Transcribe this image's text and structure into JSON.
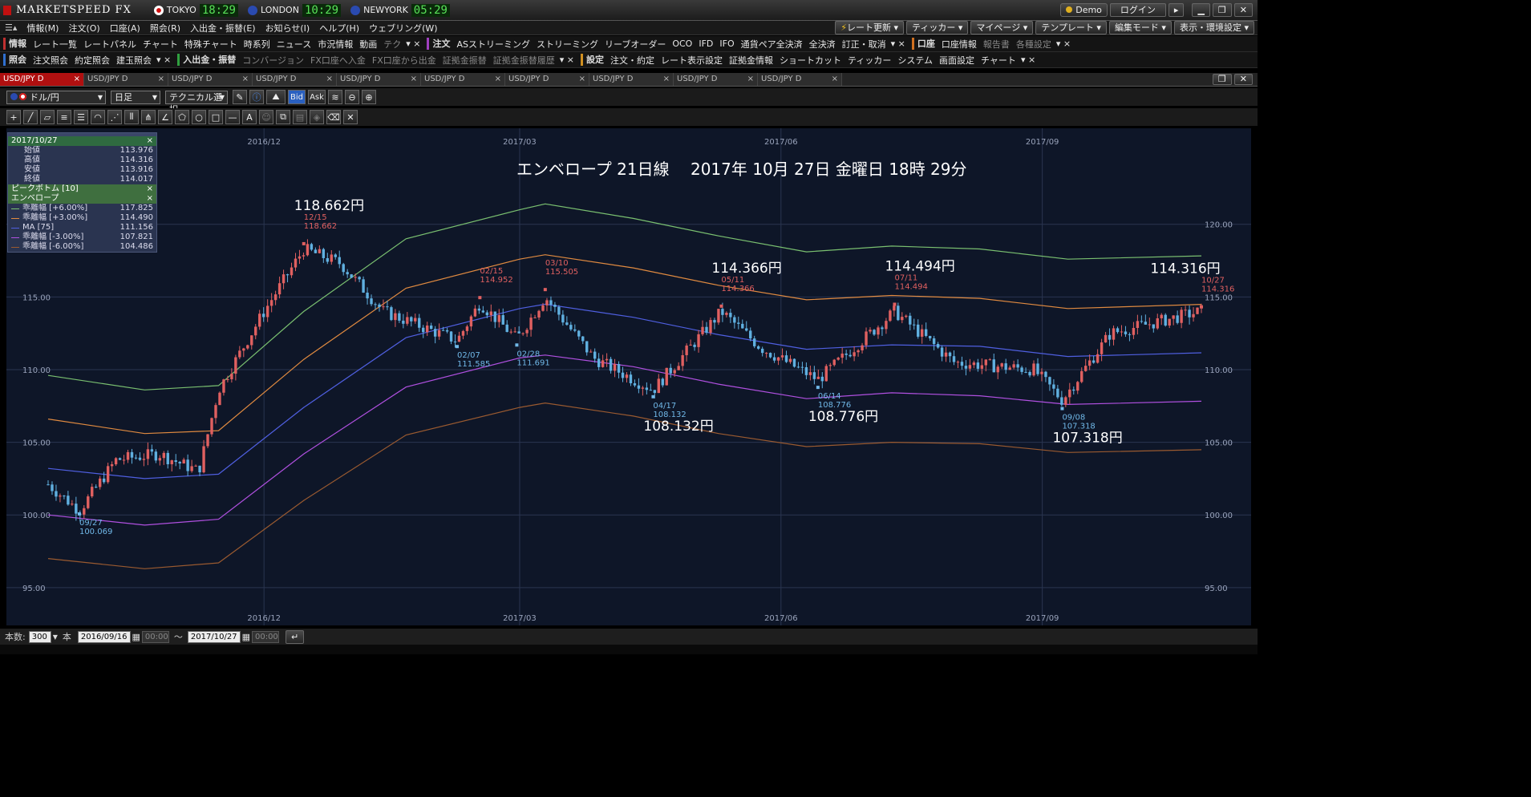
{
  "app": {
    "title": "MARKETSPEED FX"
  },
  "clocks": [
    {
      "city": "TOKYO",
      "time": "18:29",
      "flag_color": "#d01010"
    },
    {
      "city": "LONDON",
      "time": "10:29",
      "flag_color": "#2a4ab0"
    },
    {
      "city": "NEWYORK",
      "time": "05:29",
      "flag_color": "#2a4ab0"
    }
  ],
  "top_right": {
    "demo": "Demo",
    "login": "ログイン"
  },
  "menu": [
    "情報(M)",
    "注文(O)",
    "口座(A)",
    "照会(R)",
    "入出金・振替(E)",
    "お知らせ(I)",
    "ヘルプ(H)",
    "ウェブリング(W)"
  ],
  "menu_right": [
    "レート更新",
    "ティッカー",
    "マイページ",
    "テンプレート",
    "編集モード",
    "表示・環境設定"
  ],
  "toolbar1": {
    "groups": [
      {
        "label": "情報",
        "color": "#c03030",
        "items": [
          "レート一覧",
          "レートパネル",
          "チャート",
          "特殊チャート",
          "時系列",
          "ニュース",
          "市況情報",
          "動画",
          "テク"
        ]
      },
      {
        "label": "注文",
        "color": "#a040c0",
        "items": [
          "ASストリーミング",
          "ストリーミング",
          "リーブオーダー",
          "OCO",
          "IFD",
          "IFO",
          "通貨ペア全決済",
          "全決済",
          "訂正・取消"
        ]
      },
      {
        "label": "口座",
        "color": "#d07020",
        "items": [
          "口座情報",
          "報告書",
          "各種設定"
        ]
      }
    ]
  },
  "toolbar2": {
    "groups": [
      {
        "label": "照会",
        "color": "#3070d0",
        "items": [
          "注文照会",
          "約定照会",
          "建玉照会"
        ]
      },
      {
        "label": "入出金・振替",
        "color": "#30a040",
        "items": [
          "コンバージョン",
          "FX口座へ入金",
          "FX口座から出金",
          "証拠金振替",
          "証拠金振替履歴"
        ]
      },
      {
        "label": "設定",
        "color": "#d09020",
        "items": [
          "注文・約定",
          "レート表示設定",
          "証拠金情報",
          "ショートカット",
          "ティッカー",
          "システム",
          "画面設定",
          "チャート"
        ]
      }
    ]
  },
  "tabs": [
    "USD/JPY D",
    "USD/JPY D",
    "USD/JPY D",
    "USD/JPY D",
    "USD/JPY D",
    "USD/JPY D",
    "USD/JPY D",
    "USD/JPY D",
    "USD/JPY D",
    "USD/JPY D"
  ],
  "chart_controls": {
    "pair": "ドル/円",
    "period": "日足",
    "technical": "テクニカル選択",
    "bid": "Bid",
    "ask": "Ask"
  },
  "drawing_tools": [
    "crosshair",
    "trend-line",
    "ruler",
    "parallel-lines",
    "fib-lines",
    "fib-arc",
    "fib-fan",
    "vertical-lines",
    "pitchfork",
    "angle",
    "pentagon",
    "circle",
    "rectangle",
    "horizontal-line",
    "text-A",
    "icon",
    "copy",
    "paste",
    "fill",
    "eraser",
    "delete"
  ],
  "legend": {
    "date": "2017/10/27",
    "ohlc": [
      {
        "label": "始値",
        "value": "113.976"
      },
      {
        "label": "高値",
        "value": "114.316"
      },
      {
        "label": "安値",
        "value": "113.916"
      },
      {
        "label": "終値",
        "value": "114.017"
      }
    ],
    "peak_bottom": "ピークボトム [10]",
    "envelope_title": "エンベロープ",
    "envelope": [
      {
        "label": "乖離幅 [+6.00%]",
        "value": "117.825",
        "color": "#7ac070"
      },
      {
        "label": "乖離幅 [+3.00%]",
        "value": "114.490",
        "color": "#e08a40"
      },
      {
        "label": "MA [75]",
        "value": "111.156",
        "color": "#4f5fe0"
      },
      {
        "label": "乖離幅 [-3.00%]",
        "value": "107.821",
        "color": "#b050e0"
      },
      {
        "label": "乖離幅 [-6.00%]",
        "value": "104.486",
        "color": "#9a5a30"
      }
    ]
  },
  "chart_title": "エンベロープ 21日線　 2017年 10月 27日 金曜日 18時 29分",
  "chart_data": {
    "type": "candlestick",
    "pair": "USD/JPY",
    "timeframe": "日足",
    "ylim": [
      93.5,
      125.5
    ],
    "y_ticks": [
      "95.00",
      "100.00",
      "105.00",
      "110.00",
      "115.00",
      "120.00"
    ],
    "x_ticks": [
      "2016/12",
      "2017/03",
      "2017/06",
      "2017/09"
    ],
    "price_points": [
      {
        "date": "2016-09-16",
        "price": 102.1
      },
      {
        "date": "2016-09-27",
        "price": 100.3
      },
      {
        "date": "2016-10-10",
        "price": 103.8
      },
      {
        "date": "2016-10-25",
        "price": 104.2
      },
      {
        "date": "2016-11-08",
        "price": 103.0
      },
      {
        "date": "2016-11-15",
        "price": 108.6
      },
      {
        "date": "2016-12-01",
        "price": 114.0
      },
      {
        "date": "2016-12-15",
        "price": 118.3
      },
      {
        "date": "2016-12-28",
        "price": 117.3
      },
      {
        "date": "2017-01-12",
        "price": 114.0
      },
      {
        "date": "2017-02-07",
        "price": 112.0
      },
      {
        "date": "2017-02-15",
        "price": 114.6
      },
      {
        "date": "2017-02-28",
        "price": 112.1
      },
      {
        "date": "2017-03-10",
        "price": 115.0
      },
      {
        "date": "2017-03-27",
        "price": 110.8
      },
      {
        "date": "2017-04-17",
        "price": 108.6
      },
      {
        "date": "2017-05-11",
        "price": 114.0
      },
      {
        "date": "2017-05-25",
        "price": 111.5
      },
      {
        "date": "2017-06-14",
        "price": 109.3
      },
      {
        "date": "2017-07-11",
        "price": 114.0
      },
      {
        "date": "2017-08-01",
        "price": 110.5
      },
      {
        "date": "2017-08-29",
        "price": 110.0
      },
      {
        "date": "2017-09-08",
        "price": 107.9
      },
      {
        "date": "2017-09-25",
        "price": 112.5
      },
      {
        "date": "2017-10-27",
        "price": 114.017
      }
    ],
    "envelope_lines": [
      {
        "name": "乖離幅 [+6.00%]",
        "color": "#7ac070",
        "points": [
          [
            "2016-09-16",
            109.6
          ],
          [
            "2016-10-20",
            108.6
          ],
          [
            "2016-11-15",
            108.9
          ],
          [
            "2016-12-15",
            114.0
          ],
          [
            "2017-01-20",
            119.0
          ],
          [
            "2017-03-01",
            121.0
          ],
          [
            "2017-03-10",
            121.4
          ],
          [
            "2017-04-10",
            120.4
          ],
          [
            "2017-05-10",
            119.2
          ],
          [
            "2017-06-10",
            118.1
          ],
          [
            "2017-07-10",
            118.5
          ],
          [
            "2017-08-10",
            118.3
          ],
          [
            "2017-09-10",
            117.6
          ],
          [
            "2017-10-27",
            117.825
          ]
        ]
      },
      {
        "name": "乖離幅 [+3.00%]",
        "color": "#e08a40",
        "points": [
          [
            "2016-09-16",
            106.6
          ],
          [
            "2016-10-20",
            105.6
          ],
          [
            "2016-11-15",
            105.8
          ],
          [
            "2016-12-15",
            110.7
          ],
          [
            "2017-01-20",
            115.6
          ],
          [
            "2017-03-01",
            117.6
          ],
          [
            "2017-03-10",
            117.9
          ],
          [
            "2017-04-10",
            117.0
          ],
          [
            "2017-05-10",
            115.8
          ],
          [
            "2017-06-10",
            114.8
          ],
          [
            "2017-07-10",
            115.1
          ],
          [
            "2017-08-10",
            114.9
          ],
          [
            "2017-09-10",
            114.2
          ],
          [
            "2017-10-27",
            114.49
          ]
        ]
      },
      {
        "name": "MA [75]",
        "color": "#4f5fe0",
        "points": [
          [
            "2016-09-16",
            103.2
          ],
          [
            "2016-10-20",
            102.5
          ],
          [
            "2016-11-15",
            102.8
          ],
          [
            "2016-12-15",
            107.4
          ],
          [
            "2017-01-20",
            112.2
          ],
          [
            "2017-03-01",
            114.2
          ],
          [
            "2017-03-10",
            114.5
          ],
          [
            "2017-04-10",
            113.6
          ],
          [
            "2017-05-10",
            112.4
          ],
          [
            "2017-06-10",
            111.4
          ],
          [
            "2017-07-10",
            111.7
          ],
          [
            "2017-08-10",
            111.6
          ],
          [
            "2017-09-10",
            110.9
          ],
          [
            "2017-10-27",
            111.156
          ]
        ]
      },
      {
        "name": "乖離幅 [-3.00%]",
        "color": "#b050e0",
        "points": [
          [
            "2016-09-16",
            100.0
          ],
          [
            "2016-10-20",
            99.3
          ],
          [
            "2016-11-15",
            99.7
          ],
          [
            "2016-12-15",
            104.2
          ],
          [
            "2017-01-20",
            108.8
          ],
          [
            "2017-03-01",
            110.8
          ],
          [
            "2017-03-10",
            111.0
          ],
          [
            "2017-04-10",
            110.2
          ],
          [
            "2017-05-10",
            109.0
          ],
          [
            "2017-06-10",
            108.0
          ],
          [
            "2017-07-10",
            108.4
          ],
          [
            "2017-08-10",
            108.2
          ],
          [
            "2017-09-10",
            107.6
          ],
          [
            "2017-10-27",
            107.821
          ]
        ]
      },
      {
        "name": "乖離幅 [-6.00%]",
        "color": "#9a5a30",
        "points": [
          [
            "2016-09-16",
            97.0
          ],
          [
            "2016-10-20",
            96.3
          ],
          [
            "2016-11-15",
            96.7
          ],
          [
            "2016-12-15",
            101.0
          ],
          [
            "2017-01-20",
            105.5
          ],
          [
            "2017-03-01",
            107.4
          ],
          [
            "2017-03-10",
            107.7
          ],
          [
            "2017-04-10",
            106.8
          ],
          [
            "2017-05-10",
            105.6
          ],
          [
            "2017-06-10",
            104.7
          ],
          [
            "2017-07-10",
            105.0
          ],
          [
            "2017-08-10",
            104.9
          ],
          [
            "2017-09-10",
            104.3
          ],
          [
            "2017-10-27",
            104.486
          ]
        ]
      }
    ],
    "peaks": [
      {
        "kind": "peak",
        "date_label": "12/15",
        "value": "118.662",
        "big": "118.662円",
        "date": "2016-12-15",
        "price": 118.662
      },
      {
        "kind": "peak",
        "date_label": "02/15",
        "value": "114.952",
        "big": "",
        "date": "2017-02-15",
        "price": 114.952
      },
      {
        "kind": "peak",
        "date_label": "03/10",
        "value": "115.505",
        "big": "",
        "date": "2017-03-10",
        "price": 115.505
      },
      {
        "kind": "peak",
        "date_label": "05/11",
        "value": "114.366",
        "big": "114.366円",
        "date": "2017-05-11",
        "price": 114.366
      },
      {
        "kind": "peak",
        "date_label": "07/11",
        "value": "114.494",
        "big": "114.494円",
        "date": "2017-07-11",
        "price": 114.494
      },
      {
        "kind": "peak",
        "date_label": "10/27",
        "value": "114.316",
        "big": "114.316円",
        "date": "2017-10-27",
        "price": 114.316
      },
      {
        "kind": "bottom",
        "date_label": "09/27",
        "value": "100.069",
        "big": "",
        "date": "2016-09-27",
        "price": 100.069
      },
      {
        "kind": "bottom",
        "date_label": "02/07",
        "value": "111.585",
        "big": "",
        "date": "2017-02-07",
        "price": 111.585
      },
      {
        "kind": "bottom",
        "date_label": "02/28",
        "value": "111.691",
        "big": "",
        "date": "2017-02-28",
        "price": 111.691
      },
      {
        "kind": "bottom",
        "date_label": "04/17",
        "value": "108.132",
        "big": "108.132円",
        "date": "2017-04-17",
        "price": 108.132
      },
      {
        "kind": "bottom",
        "date_label": "06/14",
        "value": "108.776",
        "big": "108.776円",
        "date": "2017-06-14",
        "price": 108.776
      },
      {
        "kind": "bottom",
        "date_label": "09/08",
        "value": "107.318",
        "big": "107.318円",
        "date": "2017-09-08",
        "price": 107.318
      }
    ],
    "colors": {
      "up": "#e06060",
      "down": "#60b0e0",
      "grid": "#2a3550",
      "background": "#0e1628"
    }
  },
  "bottom": {
    "count_label": "本数:",
    "count": "300",
    "unit": "本",
    "from": "2016/09/16",
    "to": "2017/10/27",
    "tilde": "〜",
    "time_ph": "00:00"
  }
}
